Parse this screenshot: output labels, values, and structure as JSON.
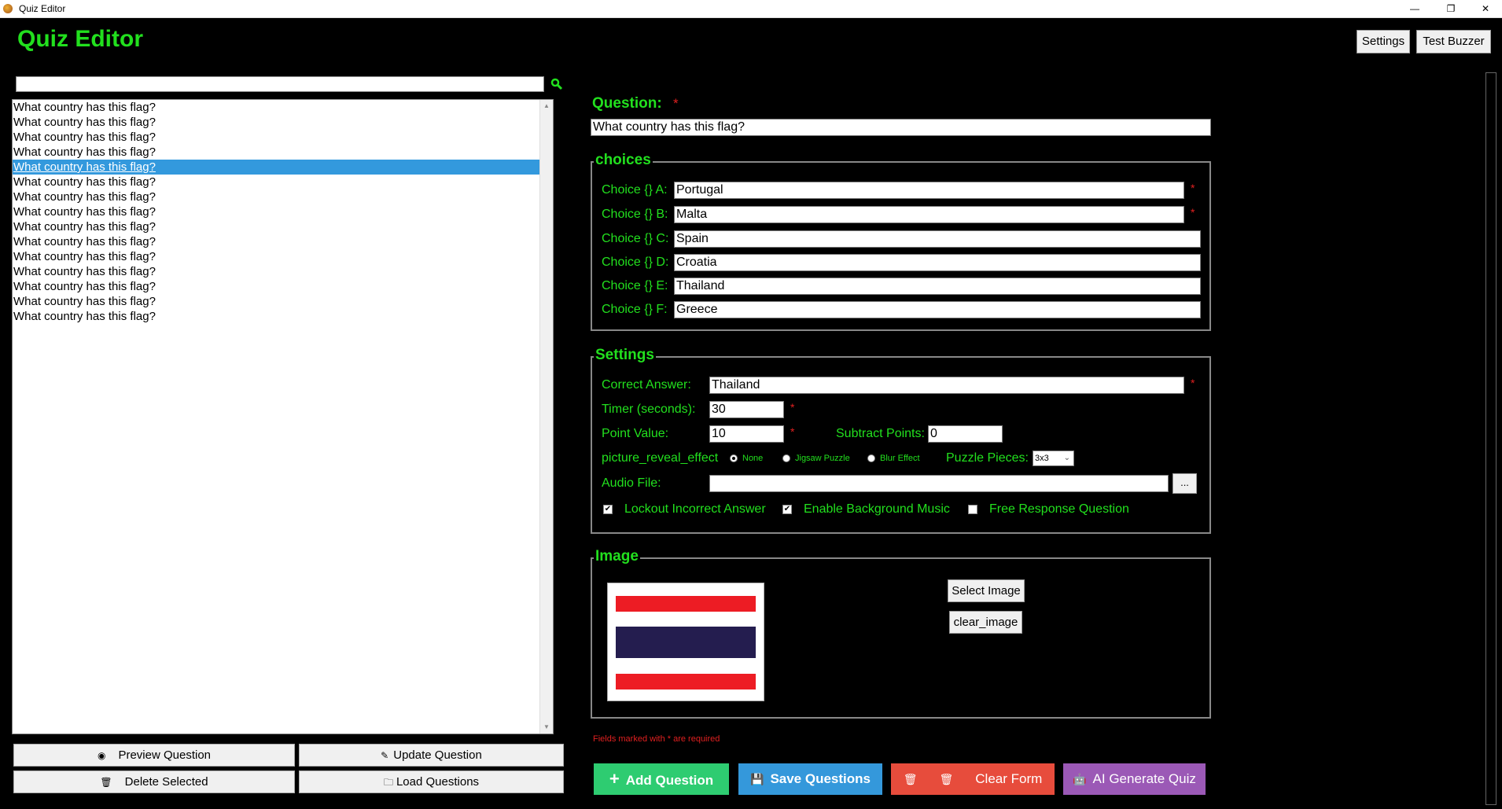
{
  "window": {
    "title": "Quiz Editor",
    "minimize": "—",
    "restore": "❐",
    "close": "✕"
  },
  "header": {
    "title": "Quiz Editor",
    "settings_button": "Settings",
    "test_buzzer_button": "Test Buzzer"
  },
  "search": {
    "value": "",
    "icon": "search-icon"
  },
  "question_list": [
    "What country has this flag?",
    "What country has this flag?",
    "What country has this flag?",
    "What country has this flag?",
    "What country has this flag?",
    "What country has this flag?",
    "What country has this flag?",
    "What country has this flag?",
    "What country has this flag?",
    "What country has this flag?",
    "What country has this flag?",
    "What country has this flag?",
    "What country has this flag?",
    "What country has this flag?",
    "What country has this flag?"
  ],
  "selected_index": 4,
  "list_buttons": {
    "preview": "Preview Question",
    "update": "Update Question",
    "delete": "Delete Selected",
    "load": "Load Questions"
  },
  "question": {
    "label": "Question:",
    "required_mark": "*",
    "value": "What country has this flag?"
  },
  "choices": {
    "title": "choices",
    "items": [
      {
        "label": "Choice {} A:",
        "value": "Portugal",
        "required": true
      },
      {
        "label": "Choice {} B:",
        "value": "Malta",
        "required": true
      },
      {
        "label": "Choice {} C:",
        "value": "Spain",
        "required": false
      },
      {
        "label": "Choice {} D:",
        "value": "Croatia",
        "required": false
      },
      {
        "label": "Choice {} E:",
        "value": "Thailand",
        "required": false
      },
      {
        "label": "Choice {} F:",
        "value": "Greece",
        "required": false
      }
    ]
  },
  "settings": {
    "title": "Settings",
    "correct_answer_label": "Correct Answer:",
    "correct_answer_value": "Thailand",
    "timer_label": "Timer (seconds):",
    "timer_value": "30",
    "point_value_label": "Point Value:",
    "point_value_value": "10",
    "subtract_points_label": "Subtract Points:",
    "subtract_points_value": "0",
    "picture_reveal_label": "picture_reveal_effect",
    "reveal_options": [
      "None",
      "Jigsaw Puzzle",
      "Blur Effect"
    ],
    "reveal_selected": "None",
    "puzzle_pieces_label": "Puzzle Pieces:",
    "puzzle_pieces_value": "3x3",
    "audio_file_label": "Audio File:",
    "audio_file_value": "",
    "browse_button": "...",
    "lockout_label": "Lockout Incorrect Answer",
    "lockout_checked": true,
    "bg_music_label": "Enable Background Music",
    "bg_music_checked": true,
    "free_response_label": "Free Response Question",
    "free_response_checked": false
  },
  "image": {
    "title": "Image",
    "select_button": "Select Image",
    "clear_button": "clear_image",
    "flag_colors": [
      "#ed1c24",
      "#ffffff",
      "#241d4f",
      "#ffffff",
      "#ed1c24"
    ]
  },
  "required_note": "Fields marked with * are required",
  "actions": {
    "add": "Add Question",
    "save": "Save Questions",
    "clear": "Clear Form",
    "ai": "AI Generate Quiz"
  },
  "colors": {
    "accent_green": "#22e01e",
    "add_green": "#2ecc71",
    "save_blue": "#3498db",
    "clear_red": "#e74c3c",
    "ai_purple": "#9b59b6"
  }
}
